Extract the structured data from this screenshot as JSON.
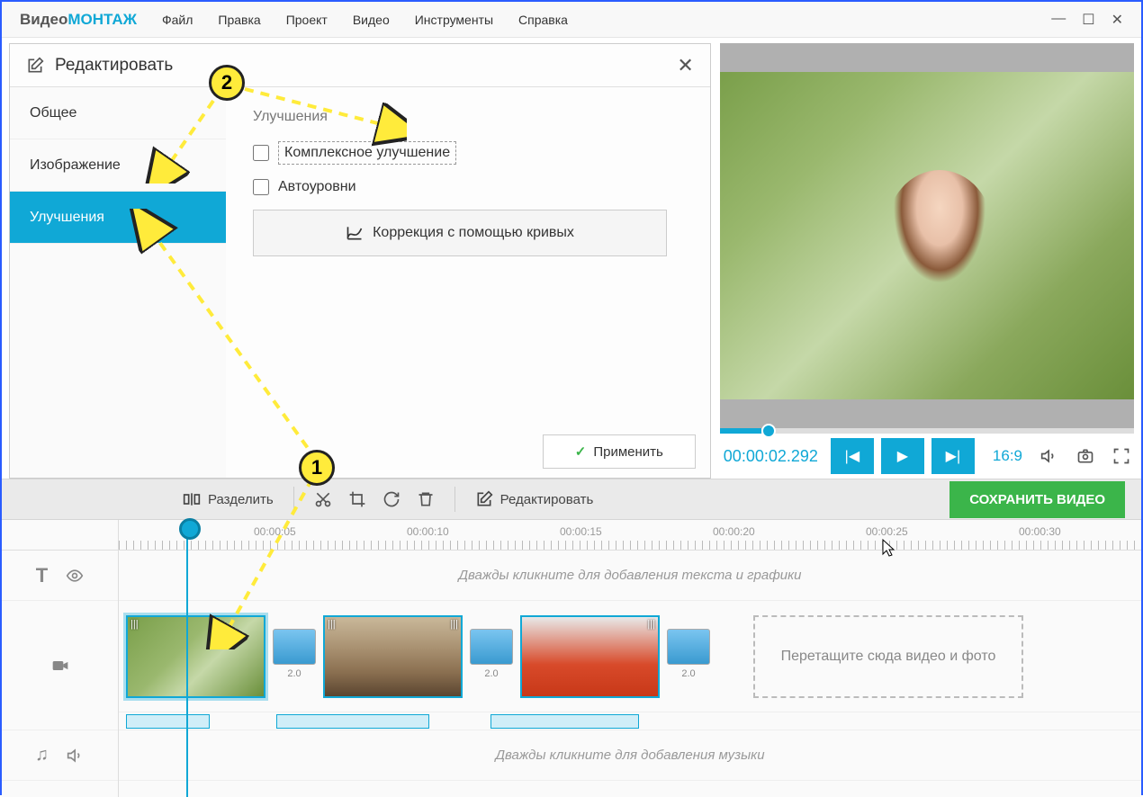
{
  "app": {
    "logo_a": "Видео",
    "logo_b": "МОНТАЖ"
  },
  "menu": [
    "Файл",
    "Правка",
    "Проект",
    "Видео",
    "Инструменты",
    "Справка"
  ],
  "panel": {
    "title": "Редактировать",
    "tabs": {
      "general": "Общее",
      "image": "Изображение",
      "enhance": "Улучшения"
    },
    "section": "Улучшения",
    "chk_complex": "Комплексное улучшение",
    "chk_auto": "Автоуровни",
    "curves_btn": "Коррекция с помощью кривых",
    "apply": "Применить"
  },
  "preview": {
    "time": "00:00:02.292",
    "aspect": "16:9"
  },
  "toolbar": {
    "split": "Разделить",
    "edit": "Редактировать",
    "save": "СОХРАНИТЬ ВИДЕО"
  },
  "ruler": [
    "00:00:05",
    "00:00:10",
    "00:00:15",
    "00:00:20",
    "00:00:25",
    "00:00:30"
  ],
  "tracks": {
    "text_hint": "Дважды кликните для добавления текста и графики",
    "dropzone": "Перетащите сюда видео и фото",
    "music_hint": "Дважды кликните для добавления музыки",
    "trans_dur": "2.0"
  },
  "annotations": {
    "b1": "1",
    "b2": "2"
  }
}
